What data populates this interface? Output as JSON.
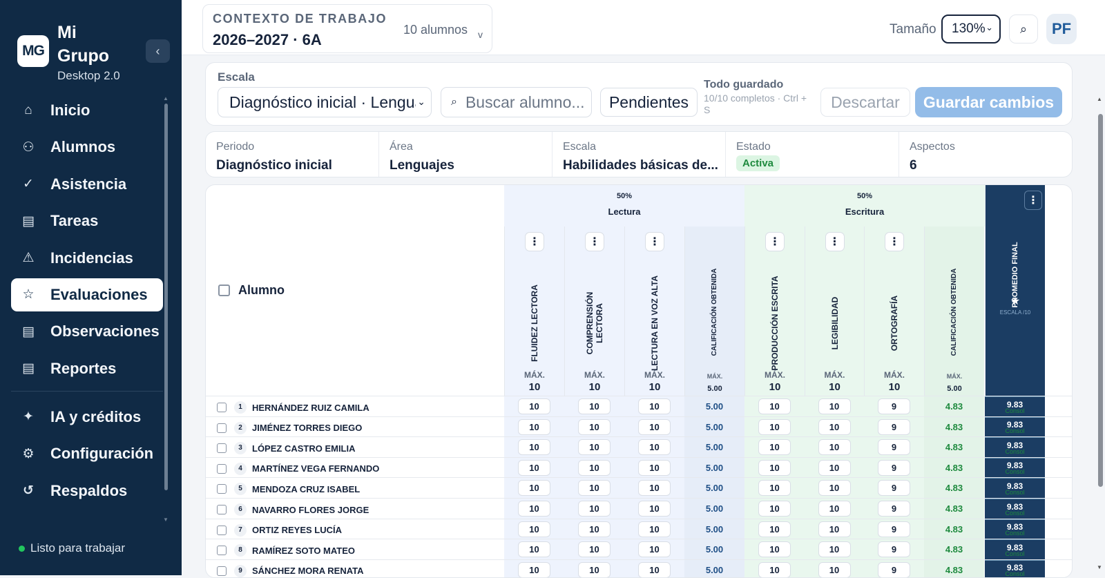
{
  "brand": {
    "initials": "MG",
    "name": "Mi Grupo",
    "subtitle": "Desktop 2.0"
  },
  "nav": {
    "main": [
      {
        "label": "Inicio",
        "icon": "home-icon",
        "glyph": "⌂"
      },
      {
        "label": "Alumnos",
        "icon": "users-icon",
        "glyph": "⚇"
      },
      {
        "label": "Asistencia",
        "icon": "attendance-icon",
        "glyph": "✓"
      },
      {
        "label": "Tareas",
        "icon": "tasks-icon",
        "glyph": "▤"
      },
      {
        "label": "Incidencias",
        "icon": "warning-icon",
        "glyph": "⚠"
      },
      {
        "label": "Evaluaciones",
        "icon": "star-icon",
        "glyph": "☆",
        "active": true
      },
      {
        "label": "Observaciones",
        "icon": "notes-icon",
        "glyph": "▤"
      },
      {
        "label": "Reportes",
        "icon": "report-icon",
        "glyph": "▤"
      }
    ],
    "secondary": [
      {
        "label": "IA y créditos",
        "icon": "sparkle-icon",
        "glyph": "✦"
      },
      {
        "label": "Configuración",
        "icon": "gear-icon",
        "glyph": "⚙"
      },
      {
        "label": "Respaldos",
        "icon": "history-icon",
        "glyph": "↺"
      }
    ]
  },
  "status": "Listo para trabajar",
  "context": {
    "label": "CONTEXTO DE TRABAJO",
    "value": "2026–2027 · 6A",
    "count": "10 alumnos",
    "chevron": "v"
  },
  "topbar": {
    "size_label": "Tamaño",
    "size_value": "130%",
    "avatar": "PF"
  },
  "toolbar": {
    "escala_label": "Escala",
    "scale_value": "Diagnóstico inicial · Lenguajes",
    "search_placeholder": "Buscar alumno...",
    "pending_label": "Pendientes",
    "saved_title": "Todo guardado",
    "saved_sub": "10/10 completos · Ctrl + S",
    "discard_label": "Descartar",
    "save_label": "Guardar cambios"
  },
  "meta": {
    "periodo": {
      "label": "Periodo",
      "value": "Diagnóstico inicial"
    },
    "area": {
      "label": "Área",
      "value": "Lenguajes"
    },
    "escala": {
      "label": "Escala",
      "value": "Habilidades básicas de..."
    },
    "estado": {
      "label": "Estado",
      "value": "Activa"
    },
    "aspectos": {
      "label": "Aspectos",
      "value": "6"
    }
  },
  "grid": {
    "alumno_header": "Alumno",
    "groups": [
      {
        "pct": "50%",
        "name": "Lectura"
      },
      {
        "pct": "50%",
        "name": "Escritura"
      }
    ],
    "columns": [
      {
        "label": "FLUIDEZ LECTORA",
        "max_label": "MÁX.",
        "max": "10",
        "kind": "input"
      },
      {
        "label": "COMPRENSIÓN LECTORA",
        "max_label": "MÁX.",
        "max": "10",
        "kind": "input"
      },
      {
        "label": "LECTURA EN VOZ ALTA",
        "max_label": "MÁX.",
        "max": "10",
        "kind": "input"
      },
      {
        "label": "CALIFICACIÓN OBTENIDA",
        "max_label": "MÁX.",
        "max": "5.00",
        "kind": "calc"
      },
      {
        "label": "PRODUCCIÓN ESCRITA",
        "max_label": "MÁX.",
        "max": "10",
        "kind": "input"
      },
      {
        "label": "LEGIBILIDAD",
        "max_label": "MÁX.",
        "max": "10",
        "kind": "input"
      },
      {
        "label": "ORTOGRAFÍA",
        "max_label": "MÁX.",
        "max": "10",
        "kind": "input"
      },
      {
        "label": "CALIFICACIÓN OBTENIDA",
        "max_label": "MÁX.",
        "max": "5.00",
        "kind": "calc"
      }
    ],
    "final": {
      "label": "PROMEDIO FINAL",
      "sub": "ESCALA /10"
    },
    "rows": [
      {
        "n": "1",
        "name": "HERNÁNDEZ RUIZ CAMILA",
        "vals": [
          "10",
          "10",
          "10",
          "5.00",
          "10",
          "10",
          "9",
          "4.83"
        ],
        "final": "9.83",
        "note": "Consol"
      },
      {
        "n": "2",
        "name": "JIMÉNEZ TORRES DIEGO",
        "vals": [
          "10",
          "10",
          "10",
          "5.00",
          "10",
          "10",
          "9",
          "4.83"
        ],
        "final": "9.83",
        "note": "Consol"
      },
      {
        "n": "3",
        "name": "LÓPEZ CASTRO EMILIA",
        "vals": [
          "10",
          "10",
          "10",
          "5.00",
          "10",
          "10",
          "9",
          "4.83"
        ],
        "final": "9.83",
        "note": "Consol"
      },
      {
        "n": "4",
        "name": "MARTÍNEZ VEGA FERNANDO",
        "vals": [
          "10",
          "10",
          "10",
          "5.00",
          "10",
          "10",
          "9",
          "4.83"
        ],
        "final": "9.83",
        "note": "Consol"
      },
      {
        "n": "5",
        "name": "MENDOZA CRUZ ISABEL",
        "vals": [
          "10",
          "10",
          "10",
          "5.00",
          "10",
          "10",
          "9",
          "4.83"
        ],
        "final": "9.83",
        "note": "Consol"
      },
      {
        "n": "6",
        "name": "NAVARRO FLORES JORGE",
        "vals": [
          "10",
          "10",
          "10",
          "5.00",
          "10",
          "10",
          "9",
          "4.83"
        ],
        "final": "9.83",
        "note": "Consol"
      },
      {
        "n": "7",
        "name": "ORTIZ REYES LUCÍA",
        "vals": [
          "10",
          "10",
          "10",
          "5.00",
          "10",
          "10",
          "9",
          "4.83"
        ],
        "final": "9.83",
        "note": "Consol"
      },
      {
        "n": "8",
        "name": "RAMÍREZ SOTO MATEO",
        "vals": [
          "10",
          "10",
          "10",
          "5.00",
          "10",
          "10",
          "9",
          "4.83"
        ],
        "final": "9.83",
        "note": "Consol"
      },
      {
        "n": "9",
        "name": "SÁNCHEZ MORA RENATA",
        "vals": [
          "10",
          "10",
          "10",
          "5.00",
          "10",
          "10",
          "9",
          "4.83"
        ],
        "final": "9.83",
        "note": "Consol"
      }
    ]
  },
  "colors": {
    "sidebar": "#102a45",
    "lectura": "#eef3fd",
    "escritura": "#e9f7ee",
    "final": "#1b3d63",
    "save": "#93bce8",
    "active_badge": "#1e8a3e"
  }
}
